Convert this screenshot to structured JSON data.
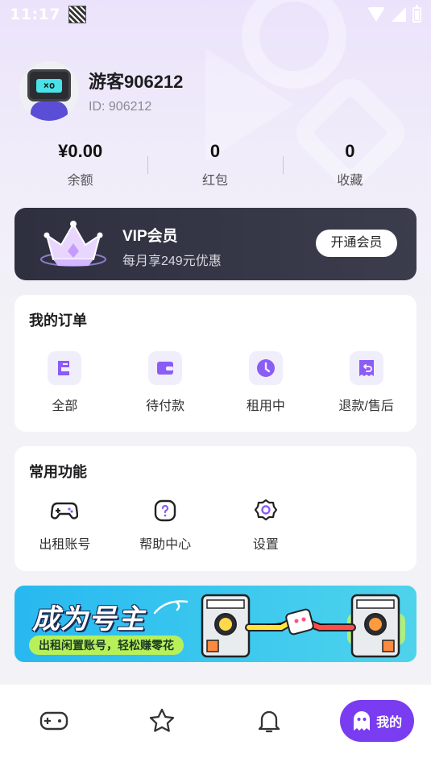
{
  "status_bar": {
    "time": "11:17"
  },
  "profile": {
    "nickname": "游客906212",
    "user_id": "ID: 906212"
  },
  "stats": [
    {
      "value": "¥0.00",
      "label": "余额"
    },
    {
      "value": "0",
      "label": "红包"
    },
    {
      "value": "0",
      "label": "收藏"
    }
  ],
  "vip": {
    "title": "VIP会员",
    "subtitle": "每月享249元优惠",
    "button": "开通会员"
  },
  "orders": {
    "title": "我的订单",
    "items": [
      {
        "label": "全部",
        "icon": "all-orders-icon"
      },
      {
        "label": "待付款",
        "icon": "wallet-icon"
      },
      {
        "label": "租用中",
        "icon": "clock-icon"
      },
      {
        "label": "退款/售后",
        "icon": "refund-icon"
      }
    ]
  },
  "functions": {
    "title": "常用功能",
    "items": [
      {
        "label": "出租账号",
        "icon": "gamepad-icon"
      },
      {
        "label": "帮助中心",
        "icon": "help-icon"
      },
      {
        "label": "设置",
        "icon": "gear-icon"
      }
    ]
  },
  "banner": {
    "title": "成为号主",
    "subtitle": "出租闲置账号，轻松赚零花"
  },
  "bottom_nav": {
    "mine_label": "我的"
  },
  "colors": {
    "accent": "#7a3cf0",
    "icon_purple": "#8b5cf6",
    "vip_bg": "#2e3040",
    "banner_blue": "#28b8f0"
  }
}
